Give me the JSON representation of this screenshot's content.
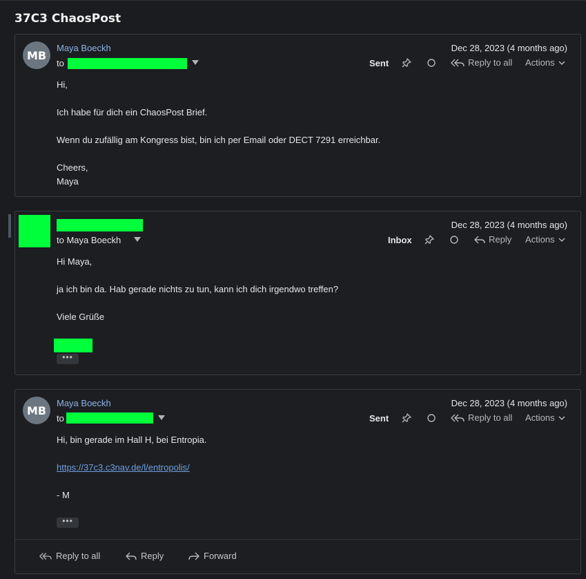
{
  "thread": {
    "title": "37C3 ChaosPost"
  },
  "messages": [
    {
      "avatar": "MB",
      "sender": "Maya Boeckh",
      "to_prefix": "to",
      "date": "Dec 28, 2023 (4 months ago)",
      "folder": "Sent",
      "reply_label": "Reply to all",
      "actions_label": "Actions",
      "body": [
        "Hi,",
        "",
        "Ich habe für dich ein ChaosPost Brief.",
        "",
        "Wenn du zufällig am Kongress bist, bin ich per Email oder DECT 7291 erreichbar.",
        "",
        "Cheers,",
        "Maya"
      ]
    },
    {
      "to_text": "to Maya Boeckh",
      "date": "Dec 28, 2023 (4 months ago)",
      "folder": "Inbox",
      "reply_label": "Reply",
      "actions_label": "Actions",
      "body": [
        "Hi Maya,",
        "",
        "ja ich bin da. Hab gerade nichts zu tun, kann ich dich irgendwo treffen?",
        "",
        "Viele Grüße"
      ],
      "ellipsis": "•••"
    },
    {
      "avatar": "MB",
      "sender": "Maya Boeckh",
      "to_prefix": "to",
      "date": "Dec 28, 2023 (4 months ago)",
      "folder": "Sent",
      "reply_label": "Reply to all",
      "actions_label": "Actions",
      "body_line1": "Hi, bin gerade im Hall H, bei Entropia.",
      "link": "https://37c3.c3nav.de/l/entropolis/",
      "signoff": "- M",
      "ellipsis": "•••"
    }
  ],
  "footer": {
    "reply_all": "Reply to all",
    "reply": "Reply",
    "forward": "Forward"
  },
  "colors": {
    "background": "#1a1c1f",
    "sender": "#8fb3e6",
    "link": "#6fa0e0",
    "redaction": "#00ff3b",
    "avatar": "#6c7680"
  },
  "icons": [
    "pin-icon",
    "unread-dot-icon",
    "reply-all-icon",
    "reply-icon",
    "forward-icon",
    "chevron-down-icon",
    "caret-down-icon"
  ]
}
